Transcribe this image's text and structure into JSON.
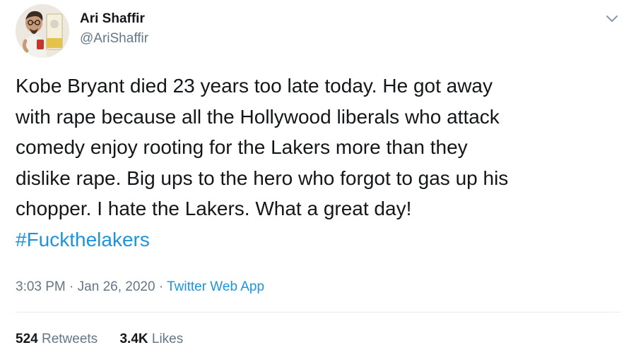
{
  "author": {
    "display_name": "Ari Shaffir",
    "handle": "@AriShaffir"
  },
  "tweet": {
    "lines": [
      "Kobe Bryant died 23 years too late today. He got away",
      "with rape because all the Hollywood liberals who attack",
      "comedy enjoy rooting for the Lakers more than they",
      "dislike rape. Big ups to the hero who forgot to gas up his",
      "chopper. I hate the Lakers. What a great day!"
    ],
    "hashtag": "#Fuckthelakers"
  },
  "meta": {
    "time": "3:03 PM",
    "separator": "·",
    "date": "Jan 26, 2020",
    "source": "Twitter Web App"
  },
  "stats": {
    "retweets_count": "524",
    "retweets_label": "Retweets",
    "likes_count": "3.4K",
    "likes_label": "Likes"
  },
  "icons": {
    "menu": "chevron-down-icon"
  },
  "colors": {
    "link": "#1b95e0",
    "secondary_text": "#657786",
    "primary_text": "#14171a"
  }
}
